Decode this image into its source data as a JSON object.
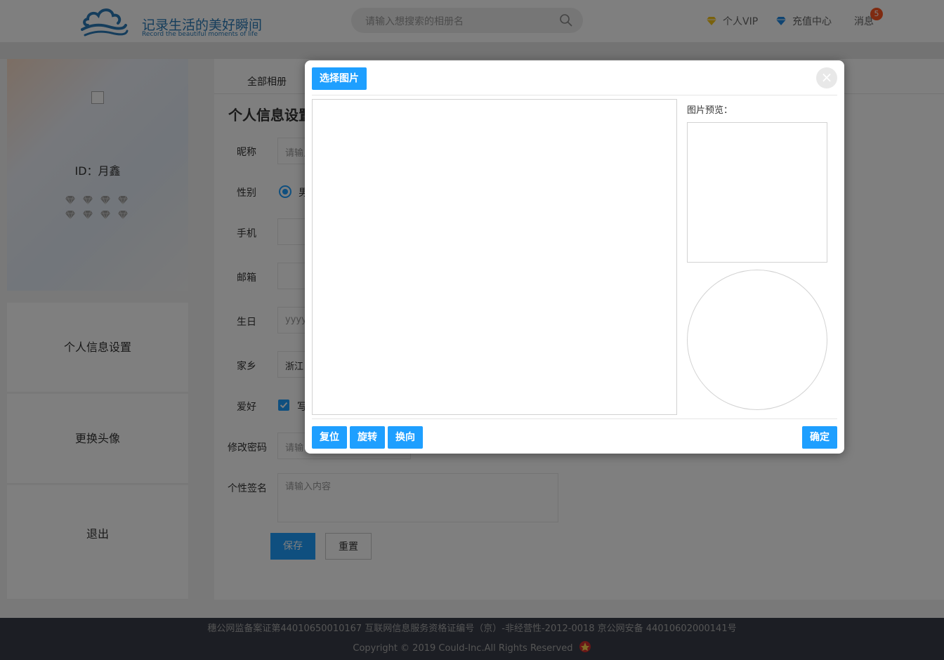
{
  "header": {
    "logo_title": "记录生活的美好瞬间",
    "logo_subtitle": "Record the beautiful moments of life",
    "search_placeholder": "请输入想搜索的相册名",
    "nav": {
      "vip": "个人VIP",
      "recharge": "充值中心",
      "messages": "消息"
    },
    "message_count": "5",
    "vip_icon_color": "#f5c518",
    "recharge_icon_color": "#1e88e5"
  },
  "profile": {
    "user_id": "ID：月鑫",
    "diamond_count": 8
  },
  "sidebar": {
    "items": [
      {
        "label": "个人信息设置"
      },
      {
        "label": "更换头像"
      },
      {
        "label": "退出"
      }
    ]
  },
  "main": {
    "tab_label": "全部相册",
    "page_title": "个人信息设置",
    "form": {
      "nickname_label": "昵称",
      "nickname_placeholder": "请输入",
      "gender_label": "性别",
      "gender_value": "男",
      "phone_label": "手机",
      "email_label": "邮箱",
      "birthday_label": "生日",
      "birthday_placeholder": "yyyy",
      "hometown_label": "家乡",
      "hometown_value": "浙江",
      "hobby_label": "爱好",
      "hobby_value": "写",
      "password_label": "修改密码",
      "password_placeholder": "请输",
      "signature_label": "个性签名",
      "signature_placeholder": "请输入内容"
    },
    "save_label": "保存",
    "reset_label": "重置"
  },
  "footer": {
    "line1": "穗公网监备案证第44010650010167   互联网信息服务资格证编号（京）-非经营性-2012-0018   京公网安备 44010602000141号",
    "line2": "Copyright  ©  2019 Could-Inc.All Rights Reserved"
  },
  "modal": {
    "select_image_label": "选择图片",
    "close_symbol": "×",
    "preview_label": "图片预览：",
    "reset_label": "复位",
    "rotate_label": "旋转",
    "flip_label": "换向",
    "confirm_label": "确定",
    "accent_color": "#1e9fff"
  }
}
